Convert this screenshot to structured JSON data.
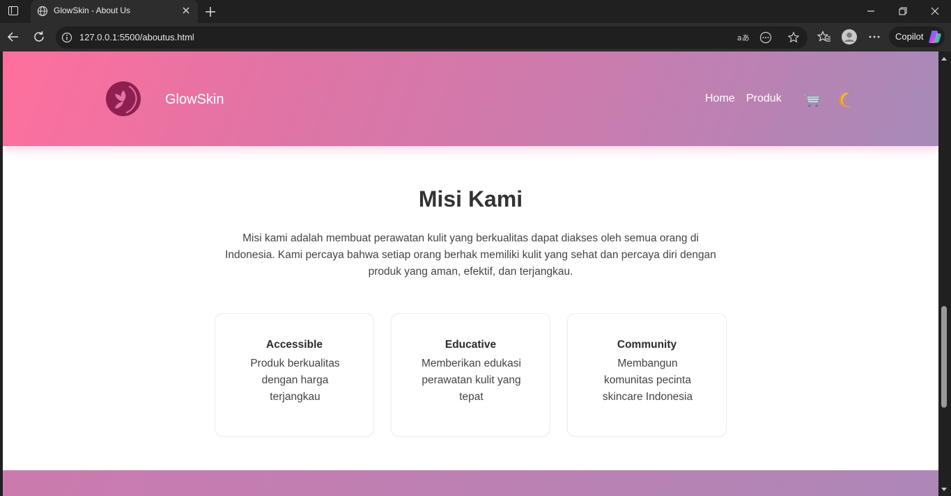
{
  "browser": {
    "tab_title": "GlowSkin - About Us",
    "url": "127.0.0.1:5500/aboutus.html",
    "copilot_label": "Copilot"
  },
  "header": {
    "brand": "GlowSkin",
    "nav": [
      "Home",
      "Produk"
    ],
    "gradient_start": "#ff6f9d",
    "gradient_end": "#a68ab8"
  },
  "mission": {
    "title": "Misi Kami",
    "text": "Misi kami adalah membuat perawatan kulit yang berkualitas dapat diakses oleh semua orang di Indonesia. Kami percaya bahwa setiap orang berhak memiliki kulit yang sehat dan percaya diri dengan produk yang aman, efektif, dan terjangkau.",
    "cards": [
      {
        "title": "Accessible",
        "desc": "Produk berkualitas dengan harga terjangkau"
      },
      {
        "title": "Educative",
        "desc": "Memberikan edukasi perawatan kulit yang tepat"
      },
      {
        "title": "Community",
        "desc": "Membangun komunitas pecinta skincare Indonesia"
      }
    ]
  },
  "icons": {
    "logo": "leaf-face-logo",
    "cart": "cart-icon",
    "theme": "moon-icon"
  },
  "colors": {
    "logo_color": "#8e1f4f",
    "text_dark": "#333333"
  }
}
